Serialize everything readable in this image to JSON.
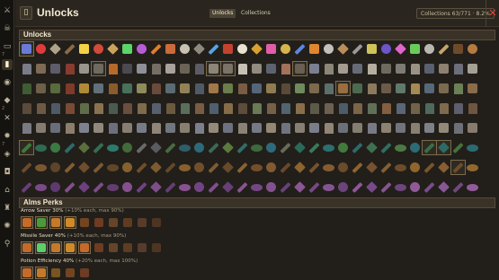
{
  "sidebar": {
    "items": [
      {
        "name": "sidebar-item-1",
        "icon": "swords-icon",
        "glyph": "⚔"
      },
      {
        "name": "sidebar-item-2",
        "icon": "skull-icon",
        "glyph": "☠"
      },
      {
        "name": "sidebar-item-3",
        "icon": "map-icon",
        "glyph": "▭",
        "num": "7"
      },
      {
        "name": "sidebar-item-4",
        "icon": "scroll-icon",
        "glyph": "▮",
        "active": true
      },
      {
        "name": "sidebar-item-5",
        "icon": "pet-icon",
        "glyph": "◉"
      },
      {
        "name": "sidebar-item-6",
        "icon": "shield-icon",
        "glyph": "◆",
        "num": "2"
      },
      {
        "name": "sidebar-item-7",
        "icon": "sword-icon",
        "glyph": "✕"
      },
      {
        "name": "sidebar-item-8",
        "icon": "gear-icon",
        "glyph": "✸",
        "num": "7"
      },
      {
        "name": "sidebar-item-9",
        "icon": "gem-icon",
        "glyph": "◈"
      },
      {
        "name": "sidebar-item-10",
        "icon": "bag-icon",
        "glyph": "◘"
      },
      {
        "name": "sidebar-item-11",
        "icon": "house-icon",
        "glyph": "⌂"
      },
      {
        "name": "sidebar-item-12",
        "icon": "trophy-icon",
        "glyph": "♜"
      },
      {
        "name": "sidebar-item-13",
        "icon": "settings-icon",
        "glyph": "✺"
      },
      {
        "name": "sidebar-item-14",
        "icon": "pin-icon",
        "glyph": "⚲"
      }
    ]
  },
  "header": {
    "icon": "book-icon",
    "icon_glyph": "▯",
    "title": "Unlocks",
    "tabs": [
      {
        "label": "Unlocks",
        "active": true
      },
      {
        "label": "Collections",
        "active": false
      }
    ],
    "collections_count": "Collections 63/771 · 8.2%",
    "close_glyph": "✕"
  },
  "sections": {
    "unlocks_title": "Unlocks",
    "perks_title": "Alms Perks"
  },
  "grid": {
    "rows": [
      {
        "kind": "misc",
        "colors": [
          "#6a7bd6",
          "#e03b3b",
          "#b0a28a",
          "#8a6b47",
          "#f4d245",
          "#d24a3a",
          "#c9a35e",
          "#5bd46a",
          "#b85cd6",
          "#e27d2e",
          "#c96b3a",
          "#c9c2b0",
          "#8f8a7e",
          "#5aa3e0",
          "#c4422f",
          "#e8e2d0",
          "#d9a030",
          "#e05da8",
          "#d6b44c",
          "#5e86e0",
          "#e0862f",
          "#c2c0bb",
          "#b98e5a",
          "#9a9a9a",
          "#d0c35b",
          "#6d55c9",
          "#e066cc",
          "#6acb5b",
          "#b8b8b0",
          "#c4a56d",
          "#6e4a2b",
          "#b77a40"
        ]
      },
      {
        "kind": "armor",
        "colors": [
          "#7b7c8a",
          "#7f6a54",
          "#5e5c6a",
          "#8a3b30",
          "#9a958c",
          "#6e6a60",
          "#b86a2a",
          "#4b4a52",
          "#8f8f98",
          "#756e64",
          "#a9a29a",
          "#6b6456",
          "#5c5a63",
          "#8c8578",
          "#7a7368",
          "#c7c0b5",
          "#918b80",
          "#5e6270",
          "#a2725a",
          "#695f52",
          "#7c7f91",
          "#8b8678",
          "#a39c90",
          "#676b78",
          "#b5ae9f",
          "#6f6a5e",
          "#7e7b74",
          "#9a9385",
          "#596070",
          "#8e8170",
          "#6c6f7a",
          "#a4a093"
        ]
      },
      {
        "kind": "armor",
        "colors": [
          "#3f5c34",
          "#6d5f48",
          "#596a3c",
          "#7f3a28",
          "#b08a36",
          "#61707b",
          "#8a5c2c",
          "#48705a",
          "#8f8b5a",
          "#6a4a3a",
          "#5a6c72",
          "#928255",
          "#4f5a66",
          "#a2774a",
          "#6a7d4a",
          "#7a5c44",
          "#55667a",
          "#8f7c50",
          "#5a4a38",
          "#6f8a5c",
          "#7c6a4c",
          "#5d6f6a",
          "#9a6e3e",
          "#4c6a50",
          "#8c7a5e",
          "#6d5a48",
          "#5f7a6a",
          "#a58a52",
          "#57687a",
          "#7a6a4e",
          "#6a8056",
          "#8a6c4a"
        ]
      },
      {
        "kind": "legs",
        "colors": [
          "#5c4a3a",
          "#6e5a42",
          "#4e5a66",
          "#7a4a34",
          "#5e6e48",
          "#8a7250",
          "#4a5c52",
          "#6a4e3e",
          "#7e6c4c",
          "#56606e",
          "#6c5a3e",
          "#5a6e5c",
          "#7a5c44",
          "#4f5f70",
          "#866c48",
          "#5e4c3c",
          "#6a7a54",
          "#786046",
          "#526470",
          "#8a6e4a",
          "#5c5a48",
          "#6e6050",
          "#4c5c6a",
          "#7c6448",
          "#607058",
          "#845e40",
          "#5a6678",
          "#726248",
          "#4e6a5c",
          "#806a4e",
          "#5e5e6c",
          "#6e5640"
        ]
      },
      {
        "kind": "armor",
        "colors": [
          "#7a7a82",
          "#847c70",
          "#6a6e7a",
          "#8c7e6c",
          "#7e8290",
          "#90887c",
          "#6c707c",
          "#867e72",
          "#787c88",
          "#8e8678",
          "#72767e",
          "#88806e",
          "#7c808c",
          "#948a7a",
          "#6e7280",
          "#8a8274",
          "#767a86",
          "#928874",
          "#70747e",
          "#868072",
          "#7a7e8a",
          "#908676",
          "#6c7078",
          "#847e70",
          "#787a84",
          "#8c8272",
          "#72747c",
          "#888070",
          "#7e8088",
          "#928a78",
          "#6e7078",
          "#867c6e"
        ]
      },
      {
        "kind": "tools",
        "colors": [
          "#3f7a3a",
          "#2f6a52",
          "#3b7a44",
          "#2e6a6a",
          "#5c6e3e",
          "#356e52",
          "#2c7a6a",
          "#426a3a",
          "#6a6a6a",
          "#5a5a62",
          "#4a6a42",
          "#2e5e6a",
          "#2c6a7a",
          "#3a6a58",
          "#5a7a3e",
          "#2f6e6a",
          "#3c6a3e",
          "#2e6a7c",
          "#6a6a5a",
          "#2a6a5a",
          "#3a7a5a",
          "#2e6e70",
          "#427a3e",
          "#2c6a6a",
          "#3e7050",
          "#2f6e62",
          "#4a7a42",
          "#2d6a74",
          "#3a6e48",
          "#2f6a66",
          "#44723c",
          "#2c6a72"
        ]
      },
      {
        "kind": "tools",
        "colors": [
          "#6a4a2a",
          "#7a5632",
          "#5e4428",
          "#845c30",
          "#6e4e2c",
          "#7c5834",
          "#624628",
          "#86602e",
          "#704e2a",
          "#7e5a32",
          "#644828",
          "#88602e",
          "#724e2c",
          "#805c34",
          "#664a2a",
          "#8a622e",
          "#744e2a",
          "#825a32",
          "#684a2a",
          "#8c642e",
          "#76522c",
          "#845c32",
          "#6a4c2a",
          "#8e642e",
          "#785230",
          "#865e32",
          "#6c4c2a",
          "#90662e",
          "#7a542c",
          "#885e32",
          "#6e4c2a",
          "#92682e"
        ]
      },
      {
        "kind": "tools",
        "colors": [
          "#6a3e7a",
          "#7a4a86",
          "#5e3a70",
          "#844e8c",
          "#6e4080",
          "#7c4c88",
          "#623c72",
          "#86508e",
          "#704282",
          "#7e4e8a",
          "#643e74",
          "#885290",
          "#724484",
          "#80508c",
          "#664076",
          "#8a5492",
          "#744686",
          "#82528e",
          "#684278",
          "#8c5694",
          "#764888",
          "#845490",
          "#6a447a",
          "#8e5896",
          "#784a8a",
          "#865692",
          "#6c467c",
          "#905a98",
          "#7a4c8c",
          "#885894",
          "#6e487e",
          "#925c9a"
        ]
      }
    ],
    "highlighted": [
      [
        0,
        0
      ],
      [
        1,
        5
      ],
      [
        1,
        13
      ],
      [
        1,
        14
      ],
      [
        1,
        19
      ],
      [
        2,
        22
      ],
      [
        5,
        0
      ],
      [
        5,
        28
      ],
      [
        5,
        29
      ],
      [
        6,
        30
      ]
    ]
  },
  "perks": [
    {
      "name": "Arrow Saver",
      "value": "30%",
      "hint": "(+10% each, max 90%)",
      "icons": [
        "#c46a2a",
        "#4a9a3a",
        "#c47a2a",
        "#d08a2a",
        "#c46a2a",
        "#b85a2a",
        "#a66a3a",
        "#9a5a2a",
        "#8a5a3a",
        "#7a4a2a"
      ],
      "active": 4
    },
    {
      "name": "Missile Saver",
      "value": "40%",
      "hint": "(+10% each, max 90%)",
      "icons": [
        "#c46a2a",
        "#5ad06a",
        "#c47a2a",
        "#d08a2a",
        "#c46a2a",
        "#b85a2a",
        "#a66a3a",
        "#9a5a2a",
        "#8a5a3a",
        "#7a4a2a"
      ],
      "active": 5
    },
    {
      "name": "Potion Efficiency",
      "value": "40%",
      "hint": "(+20% each, max 100%)",
      "icons": [
        "#c46a2a",
        "#c47a2a",
        "#d08a2a",
        "#c46a2a",
        "#b85a2a"
      ],
      "active": 2
    }
  ]
}
